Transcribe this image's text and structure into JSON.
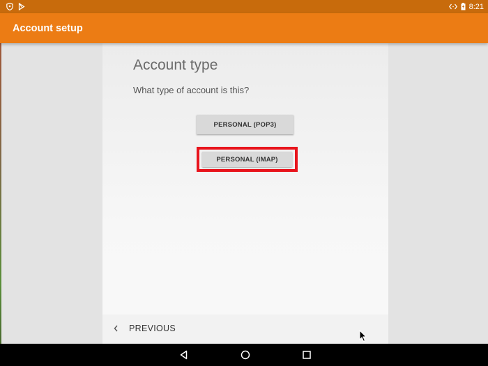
{
  "status_bar": {
    "time": "8:21",
    "icons": [
      "shield-icon",
      "play-store-icon",
      "code-brackets-icon",
      "battery-icon"
    ]
  },
  "app_bar": {
    "title": "Account setup"
  },
  "content": {
    "heading": "Account type",
    "question": "What type of account is this?",
    "options": [
      {
        "label": "PERSONAL (POP3)"
      },
      {
        "label": "PERSONAL (IMAP)",
        "highlighted": true
      }
    ]
  },
  "footer": {
    "previous_label": "PREVIOUS",
    "previous_icon": "chevron-left-icon"
  },
  "nav_bar": {
    "buttons": [
      "back-icon",
      "home-icon",
      "recents-icon"
    ]
  },
  "colors": {
    "status_bar": "#c86b0c",
    "app_bar": "#ec7c14",
    "highlight": "#e8141c"
  }
}
